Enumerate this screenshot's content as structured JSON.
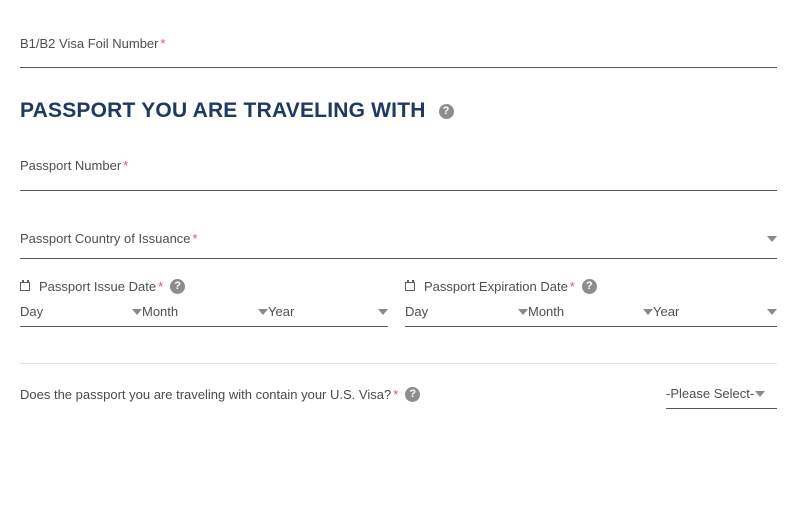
{
  "form": {
    "visa_foil": {
      "label": "B1/B2 Visa Foil Number",
      "required_marker": "*",
      "value": ""
    },
    "section": {
      "heading": "PASSPORT YOU ARE TRAVELING WITH",
      "help_icon": "help-icon",
      "help_glyph": "?"
    },
    "passport_number": {
      "label": "Passport Number",
      "required_marker": "*",
      "value": ""
    },
    "country_of_issuance": {
      "label": "Passport Country of Issuance",
      "required_marker": "*",
      "value": "",
      "caret_icon": "chevron-down-icon"
    },
    "issue_date": {
      "label": "Passport Issue Date",
      "required_marker": "*",
      "calendar_icon": "calendar-icon",
      "help_glyph": "?",
      "day": "Day",
      "month": "Month",
      "year": "Year"
    },
    "expiration_date": {
      "label": "Passport Expiration Date",
      "required_marker": "*",
      "calendar_icon": "calendar-icon",
      "help_glyph": "?",
      "day": "Day",
      "month": "Month",
      "year": "Year"
    },
    "visa_question": {
      "label": "Does the passport you are traveling with contain your U.S. Visa?",
      "required_marker": "*",
      "help_glyph": "?",
      "selected": "-Please Select-",
      "caret_icon": "chevron-down-icon"
    }
  },
  "colors": {
    "heading": "#1f3864",
    "required": "#e8525f",
    "label": "#4f4f4f",
    "field_underline": "#555a5e",
    "divider": "#e4e4e4",
    "icon_gray": "#8d8d8d"
  }
}
